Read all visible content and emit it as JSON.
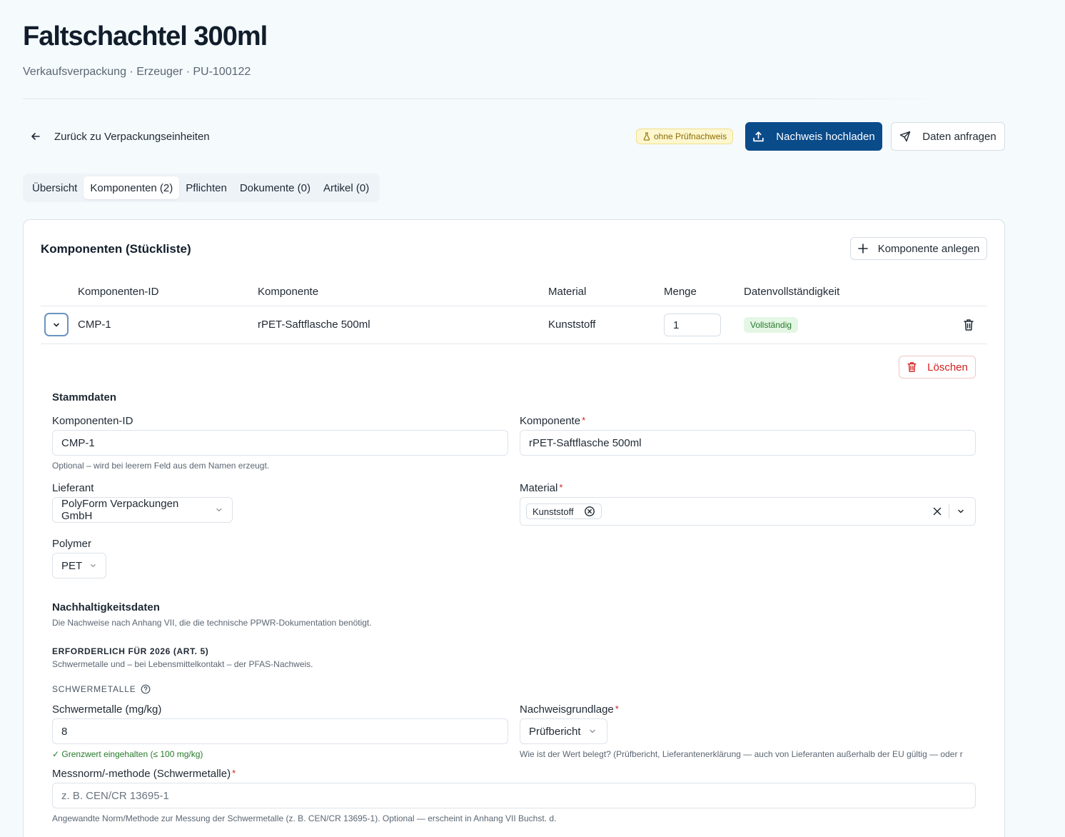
{
  "header": {
    "title": "Faltschachtel 300ml",
    "subtitle": "Verkaufsverpackung · Erzeuger · PU-100122"
  },
  "toolbar": {
    "back_label": "Zurück zu Verpackungseinheiten",
    "status_badge": "ohne Prüfnachweis",
    "upload_label": "Nachweis hochladen",
    "request_label": "Daten anfragen"
  },
  "tabs": [
    {
      "label": "Übersicht",
      "active": false
    },
    {
      "label": "Komponenten (2)",
      "active": true
    },
    {
      "label": "Pflichten",
      "active": false
    },
    {
      "label": "Dokumente (0)",
      "active": false
    },
    {
      "label": "Artikel (0)",
      "active": false
    }
  ],
  "card": {
    "title": "Komponenten (Stückliste)",
    "add_label": "Komponente anlegen"
  },
  "table": {
    "columns": [
      "Komponenten-ID",
      "Komponente",
      "Material",
      "Menge",
      "Datenvollständigkeit"
    ],
    "rows": [
      {
        "id": "CMP-1",
        "name": "rPET-Saftflasche 500ml",
        "material": "Kunststoff",
        "quantity": "1",
        "completeness": "Vollständig"
      }
    ]
  },
  "detail": {
    "delete_label": "Löschen",
    "stammdaten": {
      "heading": "Stammdaten",
      "id_label": "Komponenten-ID",
      "id_value": "CMP-1",
      "id_hint": "Optional – wird bei leerem Feld aus dem Namen erzeugt.",
      "name_label": "Komponente",
      "name_value": "rPET-Saftflasche 500ml",
      "supplier_label": "Lieferant",
      "supplier_value": "PolyForm Verpackungen GmbH",
      "material_label": "Material",
      "material_chip": "Kunststoff",
      "polymer_label": "Polymer",
      "polymer_value": "PET"
    },
    "sustainability": {
      "heading": "Nachhaltigkeitsdaten",
      "description": "Die Nachweise nach Anhang VII, die die technische PPWR-Dokumentation benötigt.",
      "required_heading": "ERFORDERLICH FÜR 2026 (ART. 5)",
      "required_desc": "Schwermetalle und – bei Lebensmittelkontakt – der PFAS-Nachweis.",
      "heavy_metals_heading": "SCHWERMETALLE",
      "hm_label": "Schwermetalle (mg/kg)",
      "hm_value": "8",
      "hm_hint": "✓ Grenzwert eingehalten (≤ 100 mg/kg)",
      "basis_label": "Nachweisgrundlage",
      "basis_value": "Prüfbericht",
      "basis_hint": "Wie ist der Wert belegt? (Prüfbericht, Lieferantenerklärung — auch von Lieferanten außerhalb der EU gültig — oder r",
      "method_label": "Messnorm/-methode (Schwermetalle)",
      "method_placeholder": "z. B. CEN/CR 13695-1",
      "method_hint": "Angewandte Norm/Methode zur Messung der Schwermetalle (z. B. CEN/CR 13695-1). Optional — erscheint in Anhang VII Buchst. d."
    }
  },
  "colors": {
    "primary": "#0a4b8a",
    "success": "#277a2a",
    "danger": "#d42020",
    "warning_bg": "#fdf7cf"
  }
}
